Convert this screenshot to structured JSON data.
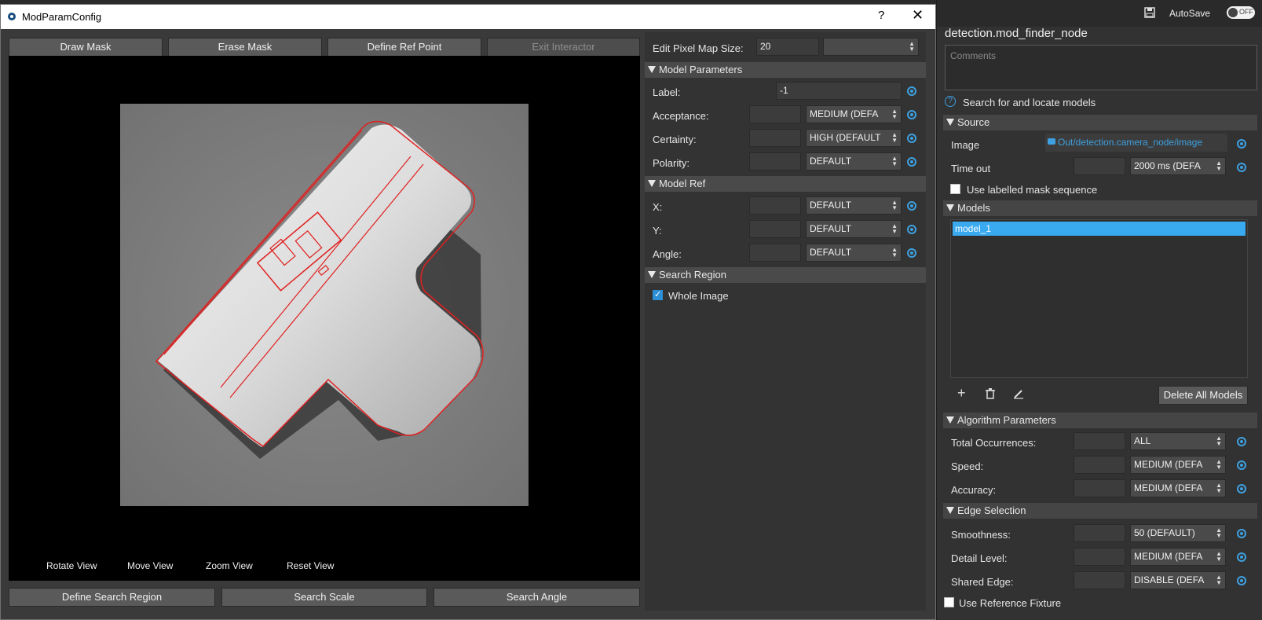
{
  "dialog": {
    "title": "ModParamConfig",
    "help": "?",
    "close": "✕",
    "toolbar": {
      "draw_mask": "Draw Mask",
      "erase_mask": "Erase Mask",
      "define_ref_point": "Define Ref Point",
      "exit_interactor": "Exit Interactor"
    },
    "view_controls": {
      "rotate": "Rotate View",
      "move": "Move View",
      "zoom": "Zoom View",
      "reset": "Reset View"
    },
    "bottom_buttons": {
      "define_search_region": "Define Search Region",
      "search_scale": "Search Scale",
      "search_angle": "Search Angle"
    },
    "params": {
      "edit_pixel_label": "Edit Pixel Map Size:",
      "edit_pixel_value": "20",
      "model_parameters": "Model Parameters",
      "label_label": "Label:",
      "label_value": "-1",
      "acceptance_label": "Acceptance:",
      "acceptance_value": "MEDIUM (DEFA",
      "certainty_label": "Certainty:",
      "certainty_value": "HIGH (DEFAULT",
      "polarity_label": "Polarity:",
      "polarity_value": "DEFAULT",
      "model_ref": "Model Ref",
      "x_label": "X:",
      "x_value": "DEFAULT",
      "y_label": "Y:",
      "y_value": "DEFAULT",
      "angle_label": "Angle:",
      "angle_value": "DEFAULT",
      "search_region": "Search Region",
      "whole_image": "Whole Image"
    }
  },
  "node": {
    "autosave_label": "AutoSave",
    "toggle_state": "OFF",
    "title": "detection.mod_finder_node",
    "comments_placeholder": "Comments",
    "description": "Search for and locate models",
    "source_section": "Source",
    "image_label": "Image",
    "image_value": "Out/detection.camera_node/image",
    "timeout_label": "Time out",
    "timeout_value": "2000 ms (DEFA",
    "labelled_mask": "Use labelled mask sequence",
    "models_section": "Models",
    "models": [
      "model_1"
    ],
    "delete_all": "Delete All Models",
    "algo_section": "Algorithm Parameters",
    "total_occ_label": "Total Occurrences:",
    "total_occ_value": "ALL",
    "speed_label": "Speed:",
    "speed_value": "MEDIUM (DEFA",
    "accuracy_label": "Accuracy:",
    "accuracy_value": "MEDIUM (DEFA",
    "edge_section": "Edge Selection",
    "smoothness_label": "Smoothness:",
    "smoothness_value": "50 (DEFAULT)",
    "detail_label": "Detail Level:",
    "detail_value": "MEDIUM (DEFA",
    "shared_edge_label": "Shared Edge:",
    "shared_edge_value": "DISABLE (DEFA",
    "ref_fixture": "Use Reference Fixture"
  },
  "colors": {
    "accent": "#3ea0e0",
    "selection": "#39a9f0",
    "contour": "#e02020"
  }
}
